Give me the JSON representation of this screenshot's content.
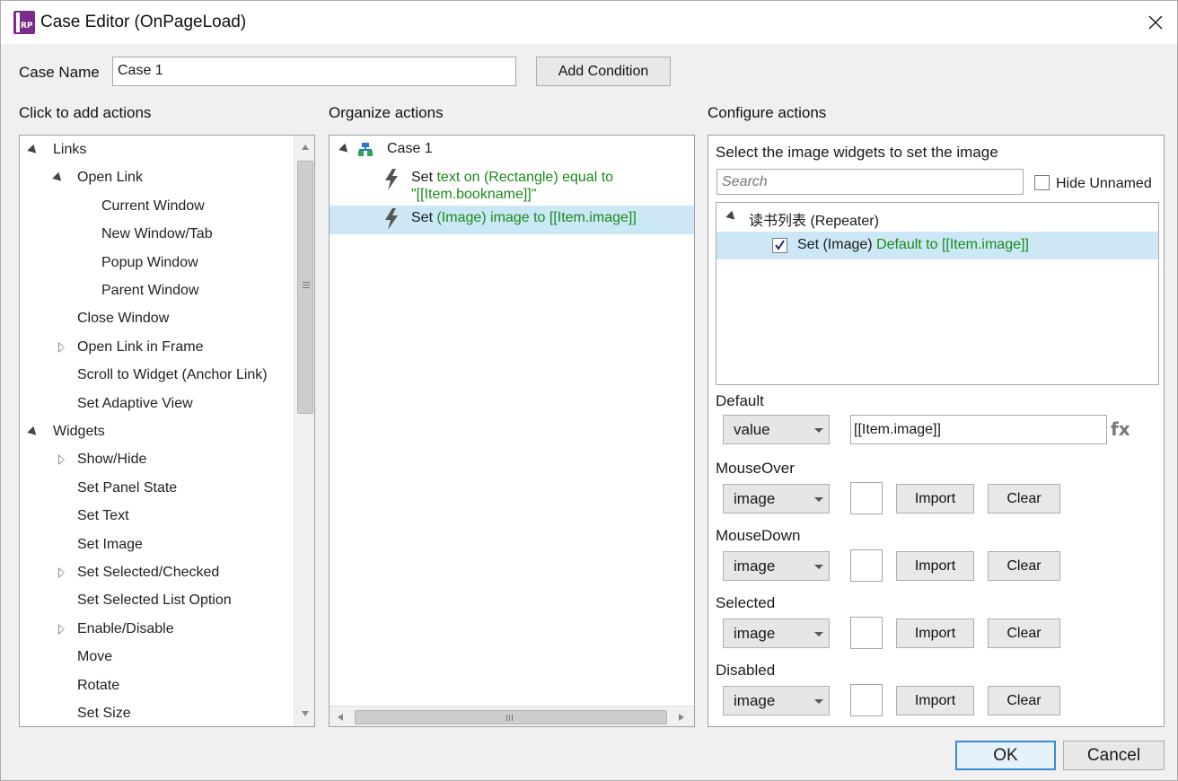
{
  "window": {
    "title": "Case Editor (OnPageLoad)",
    "app_icon_text": "RP"
  },
  "case_name": {
    "label": "Case Name",
    "value": "Case 1",
    "add_condition_label": "Add Condition"
  },
  "sections": {
    "add_actions": "Click to add actions",
    "organize_actions": "Organize actions",
    "configure_actions": "Configure actions"
  },
  "add_actions_tree": [
    {
      "label": "Links",
      "level": 0,
      "state": "expanded"
    },
    {
      "label": "Open Link",
      "level": 1,
      "state": "expanded"
    },
    {
      "label": "Current Window",
      "level": 2,
      "state": "leaf"
    },
    {
      "label": "New Window/Tab",
      "level": 2,
      "state": "leaf"
    },
    {
      "label": "Popup Window",
      "level": 2,
      "state": "leaf"
    },
    {
      "label": "Parent Window",
      "level": 2,
      "state": "leaf"
    },
    {
      "label": "Close Window",
      "level": 1,
      "state": "leaf"
    },
    {
      "label": "Open Link in Frame",
      "level": 1,
      "state": "collapsed"
    },
    {
      "label": "Scroll to Widget (Anchor Link)",
      "level": 1,
      "state": "leaf"
    },
    {
      "label": "Set Adaptive View",
      "level": 1,
      "state": "leaf"
    },
    {
      "label": "Widgets",
      "level": 0,
      "state": "expanded"
    },
    {
      "label": "Show/Hide",
      "level": 1,
      "state": "collapsed"
    },
    {
      "label": "Set Panel State",
      "level": 1,
      "state": "leaf"
    },
    {
      "label": "Set Text",
      "level": 1,
      "state": "leaf"
    },
    {
      "label": "Set Image",
      "level": 1,
      "state": "leaf"
    },
    {
      "label": "Set Selected/Checked",
      "level": 1,
      "state": "collapsed"
    },
    {
      "label": "Set Selected List Option",
      "level": 1,
      "state": "leaf"
    },
    {
      "label": "Enable/Disable",
      "level": 1,
      "state": "collapsed"
    },
    {
      "label": "Move",
      "level": 1,
      "state": "leaf"
    },
    {
      "label": "Rotate",
      "level": 1,
      "state": "leaf"
    },
    {
      "label": "Set Size",
      "level": 1,
      "state": "leaf"
    }
  ],
  "organize": {
    "case_label": "Case 1",
    "action1": {
      "prefix": "Set ",
      "line1": "text on (Rectangle) equal to",
      "line2": "\"[[Item.bookname]]\""
    },
    "action2": {
      "prefix": "Set ",
      "text": "(Image) image to [[Item.image]]"
    }
  },
  "configure": {
    "heading": "Select the image widgets to set the image",
    "search_placeholder": "Search",
    "hide_unnamed_label": "Hide Unnamed",
    "hide_unnamed_checked": false,
    "repeater_label": "读书列表 (Repeater)",
    "widget_row": {
      "prefix": "Set (Image) ",
      "text": "Default to [[Item.image]]",
      "checked": true
    },
    "default": {
      "label": "Default",
      "mode": "value",
      "value": "[[Item.image]]",
      "fx_label": "fx"
    },
    "states": [
      {
        "label": "MouseOver",
        "mode": "image",
        "import_label": "Import",
        "clear_label": "Clear"
      },
      {
        "label": "MouseDown",
        "mode": "image",
        "import_label": "Import",
        "clear_label": "Clear"
      },
      {
        "label": "Selected",
        "mode": "image",
        "import_label": "Import",
        "clear_label": "Clear"
      },
      {
        "label": "Disabled",
        "mode": "image",
        "import_label": "Import",
        "clear_label": "Clear"
      }
    ]
  },
  "footer": {
    "ok_label": "OK",
    "cancel_label": "Cancel"
  },
  "colors": {
    "accent_green": "#1a8a1a",
    "selection": "#cce8f6",
    "app_icon": "#7b2b8a",
    "ok_border": "#3c8ad6"
  }
}
